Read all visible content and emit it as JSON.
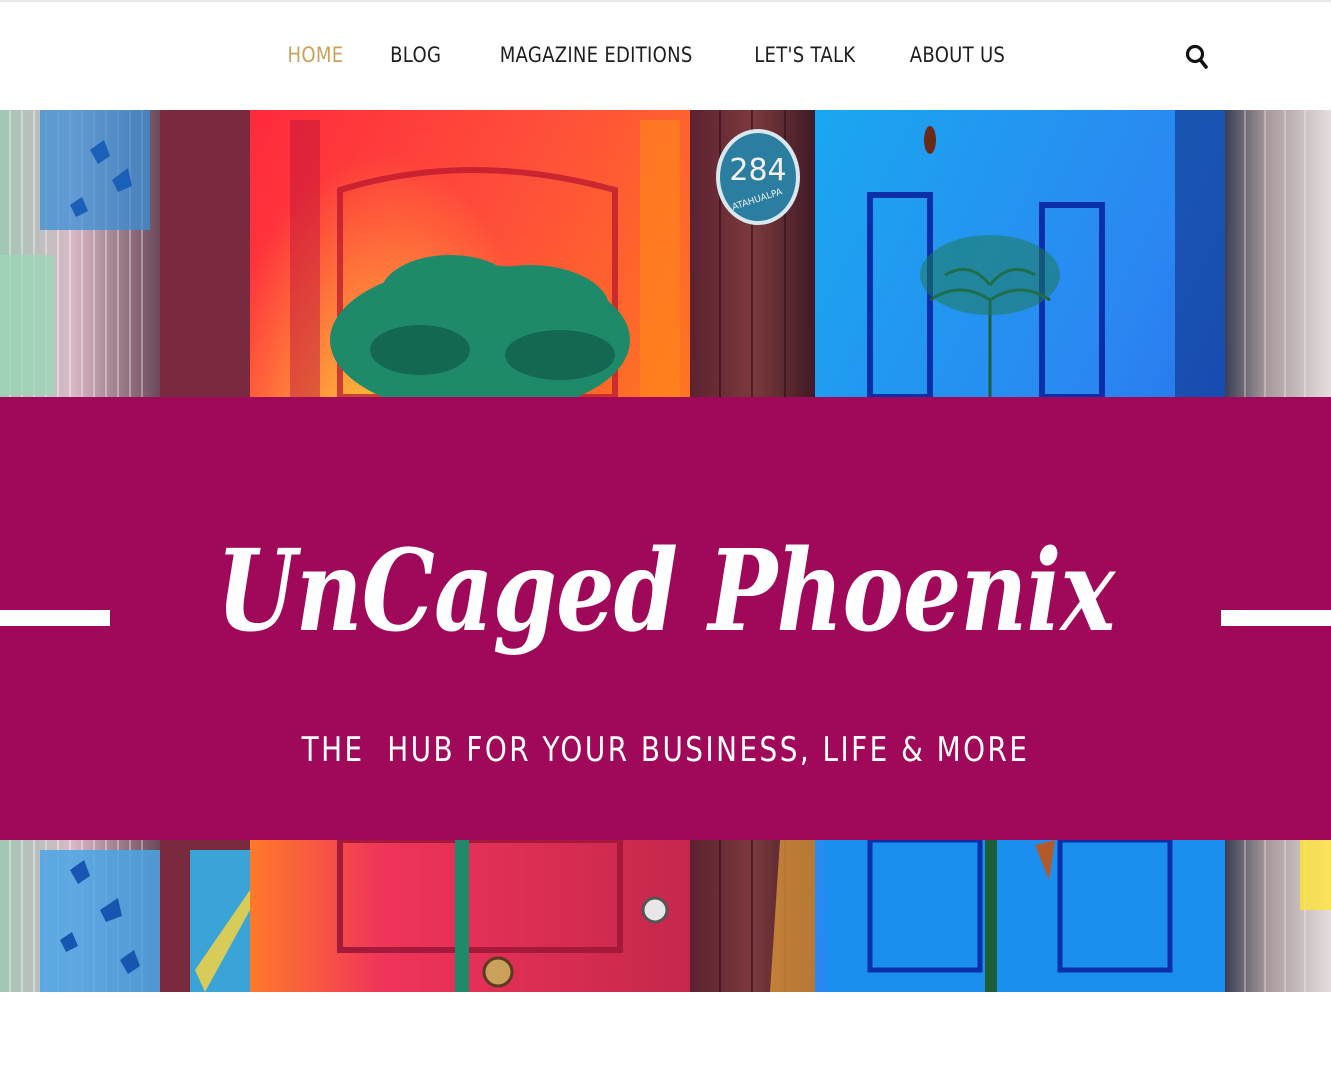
{
  "nav": {
    "items": [
      {
        "label": "HOME",
        "active": true
      },
      {
        "label": "BLOG",
        "active": false
      },
      {
        "label": "MAGAZINE EDITIONS",
        "active": false
      },
      {
        "label": "LET'S TALK",
        "active": false
      },
      {
        "label": "ABOUT US",
        "active": false
      }
    ],
    "search_icon": "search-icon",
    "active_color": "#c9a15b",
    "text_color": "#1f1f1f"
  },
  "hero": {
    "image_description_icon": "colorful-doors-photo",
    "house_number": "284",
    "house_street": "ATAHUALPA",
    "banner_color": "#a0095a",
    "title": "UnCaged Phoenix",
    "tagline": "THE  HUB FOR YOUR BUSINESS, LIFE & MORE"
  }
}
